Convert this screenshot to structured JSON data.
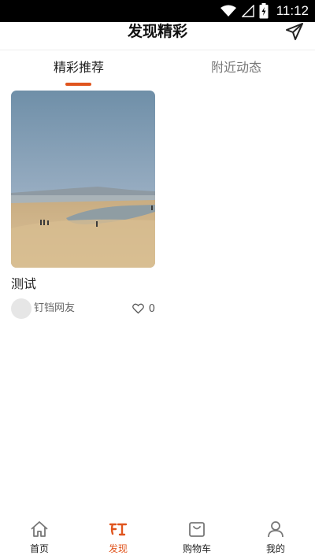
{
  "status_bar": {
    "time": "11:12"
  },
  "header": {
    "title": "发现精彩",
    "send_icon": "send-icon"
  },
  "tabs": [
    {
      "label": "精彩推荐",
      "active": true
    },
    {
      "label": "附近动态",
      "active": false
    }
  ],
  "colors": {
    "accent": "#e0551e",
    "tab_active": "#222222",
    "tab_inactive": "#777777"
  },
  "feed": [
    {
      "title": "测试",
      "author": "钉铛网友",
      "likes": "0",
      "image": "beach-photo"
    }
  ],
  "bottom_nav": [
    {
      "label": "首页",
      "icon": "home-icon",
      "active": false
    },
    {
      "label": "发现",
      "icon": "discover-icon",
      "active": true
    },
    {
      "label": "购物车",
      "icon": "cart-icon",
      "active": false
    },
    {
      "label": "我的",
      "icon": "user-icon",
      "active": false
    }
  ]
}
